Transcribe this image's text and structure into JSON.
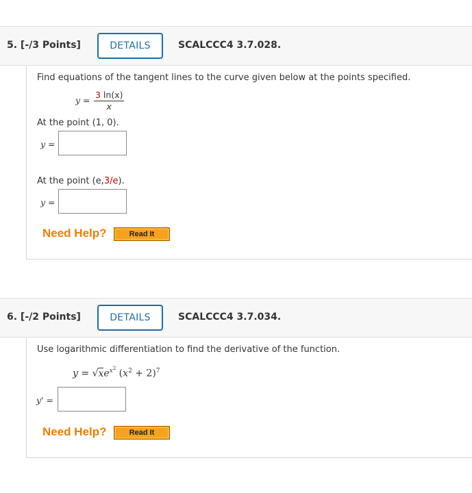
{
  "q5": {
    "number": "5.  [-/3 Points]",
    "details_label": "DETAILS",
    "code": "SCALCCC4 3.7.028.",
    "instruction": "Find equations of the tangent lines to the curve given below at the points specified.",
    "eq_lhs": "y =",
    "frac_num_coef": "3",
    "frac_num_rest": " ln(x)",
    "frac_den": "x",
    "point1_label": "At the point (1, 0).",
    "answer1_label": "y =",
    "point2_prefix": "At the point (e,",
    "point2_red": "3/e",
    "point2_suffix": ").",
    "answer2_label": "y =",
    "need_help": "Need Help?",
    "read_it": "Read It"
  },
  "q6": {
    "number": "6.  [-/2 Points]",
    "details_label": "DETAILS",
    "code": "SCALCCC4 3.7.034.",
    "instruction": "Use logarithmic differentiation to find the derivative of the function.",
    "eq_y": "y",
    "eq_equals": " = ",
    "eq_sqrt_arg": "x",
    "eq_e": "e",
    "eq_exp_x": "x",
    "eq_exp_2": "2",
    "eq_paren_open": " (",
    "eq_x": "x",
    "eq_x_exp": "2",
    "eq_plus_two": " + 2)",
    "eq_outer_exp": "7",
    "answer_label": "y' =",
    "need_help": "Need Help?",
    "read_it": "Read It"
  }
}
